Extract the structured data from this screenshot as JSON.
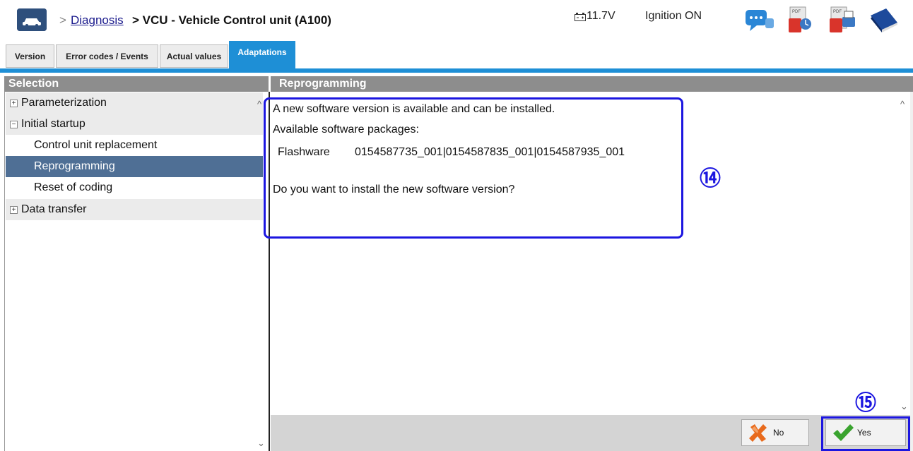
{
  "header": {
    "breadcrumb_separator": ">",
    "breadcrumb_link": "Diagnosis",
    "breadcrumb_title": "> VCU - Vehicle Control unit (A100)",
    "voltage": "11.7V",
    "ignition": "Ignition ON",
    "tool_icons": [
      "chat-icon",
      "pdf-report-icon",
      "pdf-print-icon",
      "manual-book-icon"
    ]
  },
  "tabs": [
    {
      "label": "Version"
    },
    {
      "label": "Error codes / Events"
    },
    {
      "label": "Actual values"
    },
    {
      "label": "Adaptations",
      "active": true
    }
  ],
  "selection": {
    "title": "Selection",
    "items": [
      {
        "label": "Parameterization",
        "type": "group",
        "expander": "+"
      },
      {
        "label": "Initial startup",
        "type": "group",
        "expander": "−"
      },
      {
        "label": "Control unit replacement",
        "type": "child"
      },
      {
        "label": "Reprogramming",
        "type": "child",
        "selected": true
      },
      {
        "label": "Reset of coding",
        "type": "child"
      },
      {
        "label": "Data transfer",
        "type": "group",
        "expander": "+"
      }
    ]
  },
  "reprogramming": {
    "title": "Reprogramming",
    "line1": "A new software version is available and can be installed.",
    "line2": "Available software packages:",
    "package_label": "Flashware",
    "package_value": "0154587735_001|0154587835_001|0154587935_001",
    "question": "Do you want to install the new software version?"
  },
  "callouts": {
    "step14": "⑭",
    "step15": "⑮"
  },
  "buttons": {
    "no_label": "No",
    "yes_label": "Yes"
  },
  "colors": {
    "accent_blue": "#1e8fd6",
    "selected_row": "#4f6f95",
    "header_gray": "#8d8d8d",
    "annotation_blue": "#1c16e0"
  }
}
